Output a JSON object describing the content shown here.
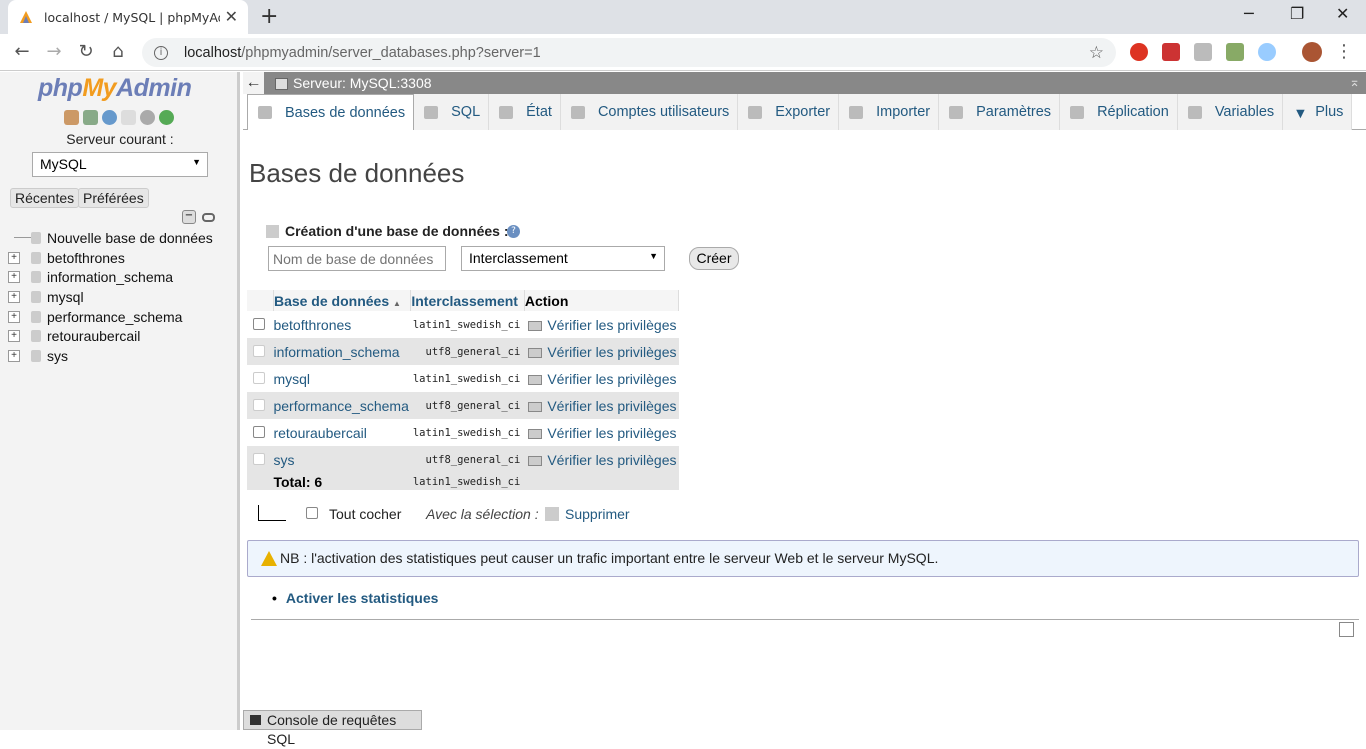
{
  "browser": {
    "tab_title": "localhost / MySQL | phpMyAdmin",
    "url_host": "localhost",
    "url_path": "/phpmyadmin/server_databases.php?server=1"
  },
  "nav": {
    "logo_php": "php",
    "logo_my": "My",
    "logo_admin": "Admin",
    "server_label": "Serveur courant :",
    "server_value": "MySQL",
    "recent_label": "Récentes",
    "favorites_label": "Préférées",
    "tree": [
      "Nouvelle base de données",
      "betofthrones",
      "information_schema",
      "mysql",
      "performance_schema",
      "retouraubercail",
      "sys"
    ]
  },
  "topbar": {
    "server": "Serveur: MySQL:3308"
  },
  "tabs": [
    "Bases de données",
    "SQL",
    "État",
    "Comptes utilisateurs",
    "Exporter",
    "Importer",
    "Paramètres",
    "Réplication",
    "Variables",
    "Plus"
  ],
  "main": {
    "title": "Bases de données",
    "create_label": "Création d'une base de données :",
    "dbname_placeholder": "Nom de base de données",
    "collation_value": "Interclassement",
    "create_button": "Créer",
    "columns": {
      "db": "Base de données",
      "collation": "Interclassement",
      "action": "Action"
    },
    "rows": [
      {
        "name": "betofthrones",
        "collation": "latin1_swedish_ci",
        "action": "Vérifier les privilèges"
      },
      {
        "name": "information_schema",
        "collation": "utf8_general_ci",
        "action": "Vérifier les privilèges"
      },
      {
        "name": "mysql",
        "collation": "latin1_swedish_ci",
        "action": "Vérifier les privilèges"
      },
      {
        "name": "performance_schema",
        "collation": "utf8_general_ci",
        "action": "Vérifier les privilèges"
      },
      {
        "name": "retouraubercail",
        "collation": "latin1_swedish_ci",
        "action": "Vérifier les privilèges"
      },
      {
        "name": "sys",
        "collation": "utf8_general_ci",
        "action": "Vérifier les privilèges"
      }
    ],
    "total_label": "Total: 6",
    "total_collation": "latin1_swedish_ci",
    "check_all": "Tout cocher",
    "with_selection": "Avec la sélection :",
    "delete": "Supprimer",
    "notice": "NB : l'activation des statistiques peut causer un trafic important entre le serveur Web et le serveur MySQL.",
    "enable_stats": "Activer les statistiques",
    "console": "Console de requêtes SQL"
  }
}
